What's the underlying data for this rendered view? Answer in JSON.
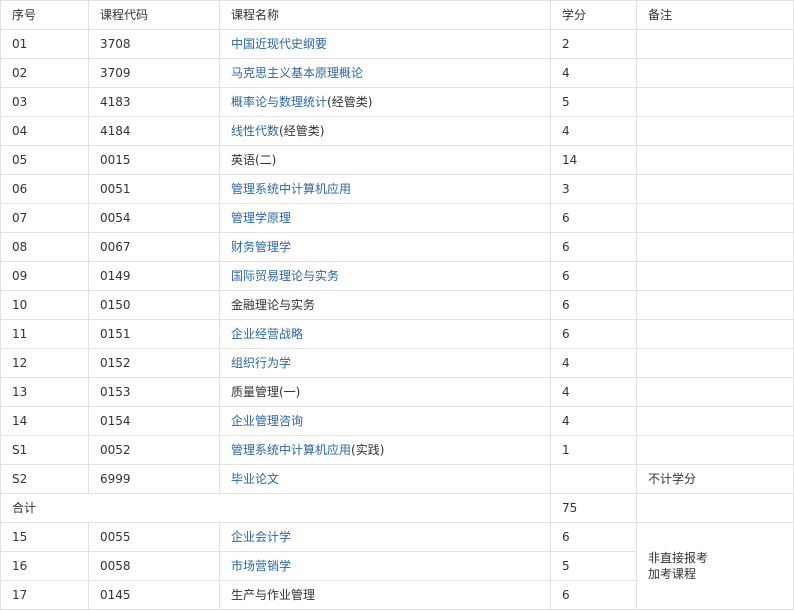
{
  "table": {
    "headers": [
      "序号",
      "课程代码",
      "课程名称",
      "学分",
      "备注"
    ],
    "rows": [
      {
        "idx": "01",
        "code": "3708",
        "name": "中国近现代史纲要",
        "name_suffix": "",
        "credit": "2",
        "note": "",
        "link": true
      },
      {
        "idx": "02",
        "code": "3709",
        "name": "马克思主义基本原理概论",
        "name_suffix": "",
        "credit": "4",
        "note": "",
        "link": true
      },
      {
        "idx": "03",
        "code": "4183",
        "name": "概率论与数理统计",
        "name_suffix": "(经管类)",
        "credit": "5",
        "note": "",
        "link": true
      },
      {
        "idx": "04",
        "code": "4184",
        "name": "线性代数",
        "name_suffix": "(经管类)",
        "credit": "4",
        "note": "",
        "link": true
      },
      {
        "idx": "05",
        "code": "0015",
        "name": "英语(二)",
        "name_suffix": "",
        "credit": "14",
        "note": "",
        "link": false
      },
      {
        "idx": "06",
        "code": "0051",
        "name": "管理系统中计算机应用",
        "name_suffix": "",
        "credit": "3",
        "note": "",
        "link": true
      },
      {
        "idx": "07",
        "code": "0054",
        "name": "管理学原理",
        "name_suffix": "",
        "credit": "6",
        "note": "",
        "link": true
      },
      {
        "idx": "08",
        "code": "0067",
        "name": "财务管理学",
        "name_suffix": "",
        "credit": "6",
        "note": "",
        "link": true
      },
      {
        "idx": "09",
        "code": "0149",
        "name": "国际贸易理论与实务",
        "name_suffix": "",
        "credit": "6",
        "note": "",
        "link": true
      },
      {
        "idx": "10",
        "code": "0150",
        "name": "金融理论与实务",
        "name_suffix": "",
        "credit": "6",
        "note": "",
        "link": false
      },
      {
        "idx": "11",
        "code": "0151",
        "name": "企业经营战略",
        "name_suffix": "",
        "credit": "6",
        "note": "",
        "link": true
      },
      {
        "idx": "12",
        "code": "0152",
        "name": "组织行为学",
        "name_suffix": "",
        "credit": "4",
        "note": "",
        "link": true
      },
      {
        "idx": "13",
        "code": "0153",
        "name": "质量管理(一)",
        "name_suffix": "",
        "credit": "4",
        "note": "",
        "link": false
      },
      {
        "idx": "14",
        "code": "0154",
        "name": "企业管理咨询",
        "name_suffix": "",
        "credit": "4",
        "note": "",
        "link": true
      },
      {
        "idx": "S1",
        "code": "0052",
        "name": "管理系统中计算机应用",
        "name_suffix": "(实践)",
        "credit": "1",
        "note": "",
        "link": true
      },
      {
        "idx": "S2",
        "code": "6999",
        "name": "毕业论文",
        "name_suffix": "",
        "credit": "",
        "note": "不计学分",
        "link": true
      }
    ],
    "total": {
      "label": "合计",
      "credit": "75"
    },
    "extra_rows": [
      {
        "idx": "15",
        "code": "0055",
        "name": "企业会计学",
        "credit": "6",
        "link": true
      },
      {
        "idx": "16",
        "code": "0058",
        "name": "市场营销学",
        "credit": "5",
        "link": true
      },
      {
        "idx": "17",
        "code": "0145",
        "name": "生产与作业管理",
        "credit": "6",
        "link": false
      }
    ],
    "extra_note_lines": [
      "非直接报考",
      "加考课程"
    ]
  },
  "colors": {
    "link": "#2b67a6",
    "text": "#333333",
    "border": "#e2e2e2"
  }
}
